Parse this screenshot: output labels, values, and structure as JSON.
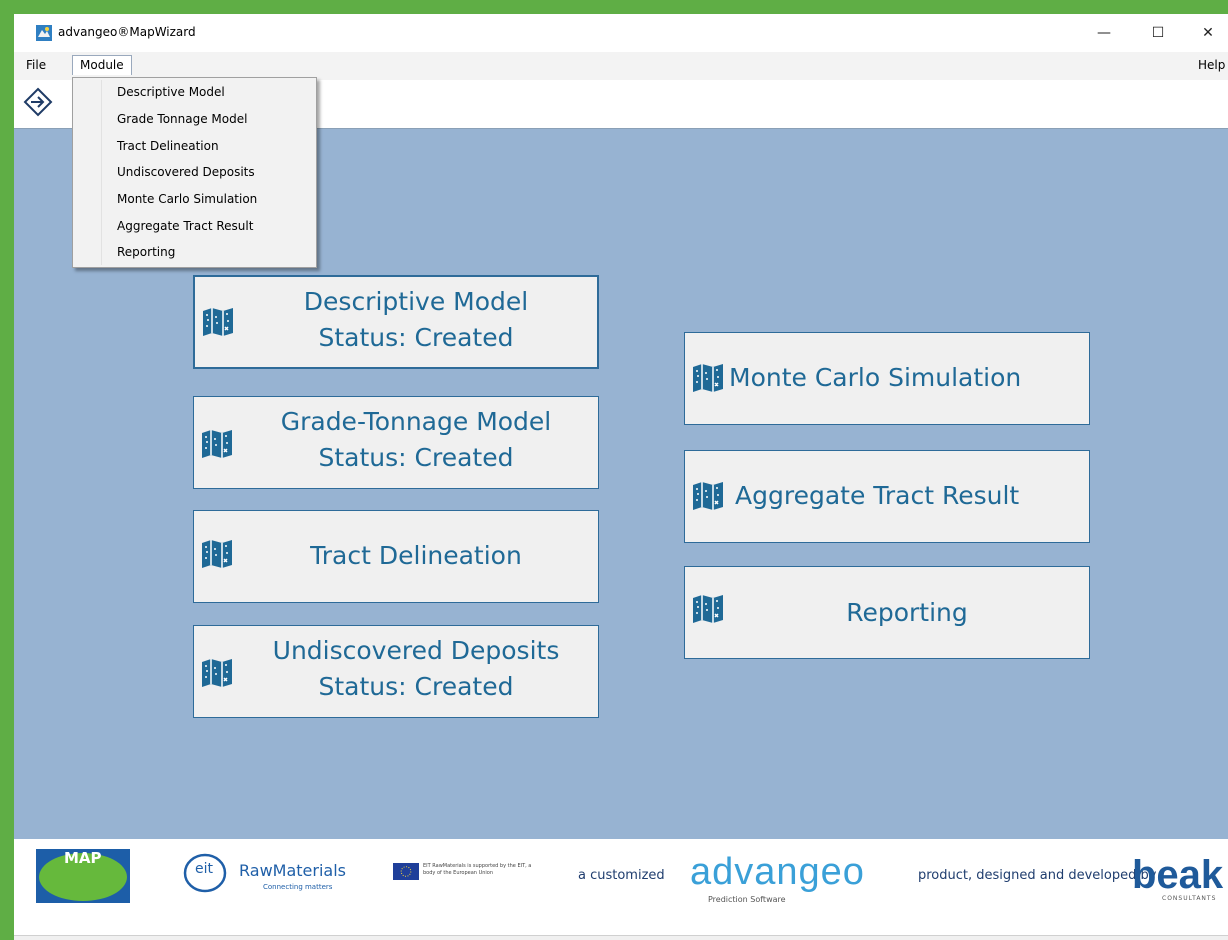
{
  "window": {
    "title": "advangeo®MapWizard",
    "minimize": "—",
    "maximize": "☐",
    "close": "✕"
  },
  "menubar": {
    "file": "File",
    "module": "Module",
    "help": "Help"
  },
  "dropdown": {
    "items": [
      "Descriptive Model",
      "Grade Tonnage Model",
      "Tract Delineation",
      "Undiscovered Deposits",
      "Monte Carlo Simulation",
      "Aggregate Tract Result",
      "Reporting"
    ]
  },
  "modules": {
    "descriptive": {
      "title": "Descriptive Model",
      "status": "Status: Created"
    },
    "grade_tonnage": {
      "title": "Grade-Tonnage Model",
      "status": "Status: Created"
    },
    "tract": {
      "title": "Tract Delineation"
    },
    "undiscovered": {
      "title": "Undiscovered Deposits",
      "status": "Status: Created"
    },
    "monte_carlo": {
      "title": "Monte Carlo Simulation"
    },
    "aggregate": {
      "title": "Aggregate Tract Result"
    },
    "reporting": {
      "title": "Reporting"
    }
  },
  "footer": {
    "map_logo": "MAP",
    "eit_logo": "eit",
    "raw_materials": "RawMaterials",
    "connecting": "Connecting matters",
    "eu_note": "EIT RawMaterials is supported by the EIT, a body of the European Union",
    "credit_prefix": "a customized",
    "advangeo": "advangeo",
    "prediction": "Prediction Software",
    "credit_suffix": "product, designed and developed by",
    "beak": "beak",
    "consultants": "CONSULTANTS"
  },
  "colors": {
    "accent": "#1f6996",
    "background": "#97b3d2",
    "frame": "#5fae45"
  }
}
